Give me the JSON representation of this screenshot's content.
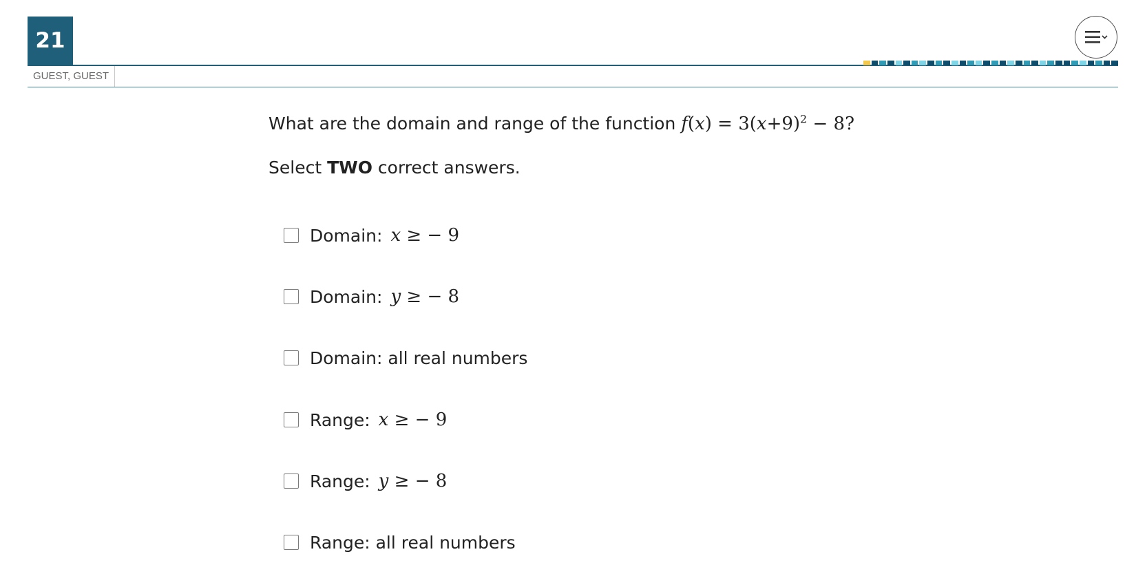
{
  "header": {
    "question_number": "21",
    "user_name": "GUEST, GUEST",
    "menu_icon": "hamburger-menu-icon",
    "progress_colors": [
      "#f2c94c",
      "#0e4d6c",
      "#2f9bb5",
      "#0e4d6c",
      "#7fd4e6",
      "#0e4d6c",
      "#2f9bb5",
      "#7fd4e6",
      "#0e4d6c",
      "#2f9bb5",
      "#0e4d6c",
      "#7fd4e6",
      "#0e4d6c",
      "#2f9bb5",
      "#7fd4e6",
      "#0e4d6c",
      "#2f9bb5",
      "#0e4d6c",
      "#7fd4e6",
      "#0e4d6c",
      "#2f9bb5",
      "#0e4d6c",
      "#7fd4e6",
      "#2f9bb5",
      "#0e4d6c",
      "#0e4d6c",
      "#2f9bb5",
      "#7fd4e6",
      "#0e4d6c",
      "#2f9bb5",
      "#0e4d6c",
      "#0e4d6c"
    ]
  },
  "question": {
    "text": "What are the domain and range of the function",
    "function": {
      "f": "f",
      "var": "x",
      "expr_prefix": "3(",
      "expr_var": "x",
      "expr_plus": "+9)",
      "exponent": "2",
      "expr_suffix": " − 8?"
    },
    "instruction_prefix": "Select ",
    "instruction_bold": "TWO",
    "instruction_suffix": " correct answers."
  },
  "options": [
    {
      "label": "Domain:",
      "var": "x",
      "rest": " ≥  − 9"
    },
    {
      "label": "Domain:",
      "var": "y",
      "rest": " ≥  − 8"
    },
    {
      "label": "Domain: all real numbers",
      "var": "",
      "rest": ""
    },
    {
      "label": "Range:",
      "var": "x",
      "rest": " ≥  − 9"
    },
    {
      "label": "Range:",
      "var": "y",
      "rest": " ≥  − 8"
    },
    {
      "label": "Range: all real numbers",
      "var": "",
      "rest": ""
    }
  ]
}
